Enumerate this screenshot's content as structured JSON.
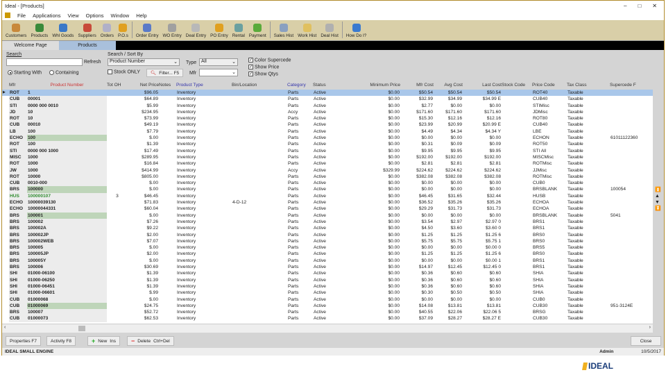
{
  "window": {
    "title": "Ideal - [Products]"
  },
  "menu": [
    "File",
    "Applications",
    "View",
    "Options",
    "Window",
    "Help"
  ],
  "toolbar": [
    {
      "label": "Customers",
      "color": "#c8883a"
    },
    {
      "label": "Products",
      "color": "#3a8a3a"
    },
    {
      "label": "Whl Goods",
      "color": "#3a78c8"
    },
    {
      "label": "Suppliers",
      "color": "#c84a3a"
    },
    {
      "label": "Orders",
      "color": "#b0b0c8"
    },
    {
      "label": "P.O.s",
      "color": "#e0a020"
    },
    {
      "label": "Order Entry",
      "color": "#5a7ac8"
    },
    {
      "label": "WO Entry",
      "color": "#a0a0a0"
    },
    {
      "label": "Deal Entry",
      "color": "#b8b8b8"
    },
    {
      "label": "PO Entry",
      "color": "#e0a020"
    },
    {
      "label": "Rental",
      "color": "#6aa0a0"
    },
    {
      "label": "Payment",
      "color": "#5aaa3a"
    },
    {
      "label": "Sales Hist",
      "color": "#8aa0c0"
    },
    {
      "label": "Work Hist",
      "color": "#e0c060"
    },
    {
      "label": "Deal Hist",
      "color": "#b0b0b0"
    },
    {
      "label": "How Do I?",
      "color": "#3a7ad0"
    }
  ],
  "tabs": [
    {
      "label": "Welcome Page"
    },
    {
      "label": "Products"
    }
  ],
  "search": {
    "label": "Search",
    "value": "",
    "refresh": "Refresh",
    "starting_with": "Starting With",
    "containing": "Containing",
    "sort_label": "Search / Sort By",
    "sort_value": "Product Number",
    "type_label": "Type",
    "type_value": "All",
    "mfr_label": "Mfr",
    "mfr_value": "",
    "stock_only": "Stock ONLY",
    "filter": "Filter... F5",
    "color_supercede": "Color Supercede",
    "show_price": "Show Price",
    "show_qtys": "Show Qtys"
  },
  "columns": [
    "Mfr",
    "Product Number",
    "Tot OH",
    "Net Price",
    "Notes",
    "Product Type",
    "Bin/Location",
    "Category",
    "Status",
    "Minimum Price",
    "Mfr Cost",
    "Avg Cost",
    "Last Cost",
    "Stock Code",
    "Price Code",
    "Tax Class",
    "Supercede F"
  ],
  "rows": [
    [
      "ROT",
      "1",
      "",
      "$96.05",
      "",
      "Inventory",
      "",
      "Parts",
      "Active",
      "$0.00",
      "$50.54",
      "$50.54",
      "$50.54",
      "",
      "ROT40",
      "Taxable",
      "",
      "sel"
    ],
    [
      "CUB",
      "00001",
      "",
      "$64.89",
      "",
      "Inventory",
      "",
      "Parts",
      "Active",
      "$0.00",
      "$32.99",
      "$34.99",
      "$34.99 E",
      "",
      "CUB40",
      "Taxable",
      "",
      ""
    ],
    [
      "STI",
      "0000 000 0010",
      "",
      "$5.99",
      "",
      "Inventory",
      "",
      "Parts",
      "Active",
      "$0.00",
      "$2.77",
      "$0.00",
      "$0.00",
      "",
      "STIMisc",
      "Taxable",
      "",
      ""
    ],
    [
      "JD",
      "10",
      "",
      "$234.95",
      "",
      "Inventory",
      "",
      "Accy",
      "Active",
      "$0.00",
      "$171.60",
      "$171.60",
      "$171.60",
      "",
      "JDMisc",
      "Taxable",
      "",
      ""
    ],
    [
      "ROT",
      "10",
      "",
      "$73.99",
      "",
      "Inventory",
      "",
      "Parts",
      "Active",
      "$0.00",
      "$15.30",
      "$12.16",
      "$12.16",
      "",
      "ROT80",
      "Taxable",
      "",
      ""
    ],
    [
      "CUB",
      "00010",
      "",
      "$49.19",
      "",
      "Inventory",
      "",
      "Parts",
      "Active",
      "$0.00",
      "$23.99",
      "$20.99",
      "$20.99 E",
      "",
      "CUB40",
      "Taxable",
      "",
      ""
    ],
    [
      "LB",
      "100",
      "",
      "$7.79",
      "",
      "Inventory",
      "",
      "Parts",
      "Active",
      "$0.00",
      "$4.49",
      "$4.34",
      "$4.34 Y",
      "",
      "LBE",
      "Taxable",
      "",
      ""
    ],
    [
      "ECHO",
      "100",
      "",
      "$.00",
      "",
      "Inventory",
      "",
      "Parts",
      "Active",
      "$0.00",
      "$0.00",
      "$0.00",
      "$0.00",
      "",
      "ECHON",
      "Taxable",
      "61011122360",
      "hl"
    ],
    [
      "ROT",
      "100",
      "",
      "$1.39",
      "",
      "Inventory",
      "",
      "Parts",
      "Active",
      "$0.00",
      "$0.31",
      "$0.09",
      "$0.09",
      "",
      "ROT50",
      "Taxable",
      "",
      ""
    ],
    [
      "STI",
      "0000 000 1000",
      "",
      "$17.49",
      "",
      "Inventory",
      "",
      "Parts",
      "Active",
      "$0.00",
      "$9.95",
      "$9.95",
      "$9.95",
      "",
      "STI All",
      "Taxable",
      "",
      ""
    ],
    [
      "MISC",
      "1000",
      "",
      "$289.95",
      "",
      "Inventory",
      "",
      "Parts",
      "Active",
      "$0.00",
      "$192.00",
      "$192.00",
      "$192.00",
      "",
      "MISCMisc",
      "Taxable",
      "",
      ""
    ],
    [
      "ROT",
      "1000",
      "",
      "$16.84",
      "",
      "Inventory",
      "",
      "Parts",
      "Active",
      "$0.00",
      "$2.81",
      "$2.81",
      "$2.81",
      "",
      "ROTMisc",
      "Taxable",
      "",
      ""
    ],
    [
      "JW",
      "1000",
      "",
      "$414.99",
      "",
      "Inventory",
      "",
      "Accy",
      "Active",
      "$329.99",
      "$224.62",
      "$224.62",
      "$224.62",
      "",
      "JJMisc",
      "Taxable",
      "",
      ""
    ],
    [
      "ROT",
      "10000",
      "",
      "$805.00",
      "",
      "Inventory",
      "",
      "Parts",
      "Active",
      "$0.00",
      "$382.08",
      "$382.08",
      "$382.08",
      "",
      "ROTMisc",
      "Taxable",
      "",
      ""
    ],
    [
      "CUB",
      "0010-000",
      "",
      "$.00",
      "",
      "Inventory",
      "",
      "Parts",
      "Active",
      "$0.00",
      "$0.00",
      "$0.00",
      "$0.00",
      "",
      "CUB0",
      "Taxable",
      "",
      ""
    ],
    [
      "BRS",
      "100000",
      "",
      "$.00",
      "",
      "Inventory",
      "",
      "Parts",
      "Active",
      "$0.00",
      "$0.00",
      "$0.00",
      "$0.00",
      "",
      "BRSBLANK",
      "Taxable",
      "100054",
      "hl"
    ],
    [
      "HUS",
      "100000107",
      "3",
      "$46.45",
      "",
      "Inventory",
      "",
      "Parts",
      "Active",
      "$0.00",
      "$46.45",
      "$31.65",
      "$32.44",
      "",
      "HUSB",
      "Taxable",
      "",
      "green"
    ],
    [
      "ECHO",
      "10000039130",
      "",
      "$71.83",
      "",
      "Inventory",
      "4-D-12",
      "Parts",
      "Active",
      "$0.00",
      "$36.52",
      "$35.26",
      "$35.26",
      "",
      "ECHOA",
      "Taxable",
      "",
      ""
    ],
    [
      "ECHO",
      "10000044331",
      "",
      "$60.04",
      "",
      "Inventory",
      "",
      "Parts",
      "Active",
      "$0.00",
      "$29.29",
      "$31.73",
      "$31.73",
      "",
      "ECHOA",
      "Taxable",
      "",
      ""
    ],
    [
      "BRS",
      "100001",
      "",
      "$.00",
      "",
      "Inventory",
      "",
      "Parts",
      "Active",
      "$0.00",
      "$0.00",
      "$0.00",
      "$0.00",
      "",
      "BRSBLANK",
      "Taxable",
      "5041",
      "hl"
    ],
    [
      "BRS",
      "100002",
      "",
      "$7.26",
      "",
      "Inventory",
      "",
      "Parts",
      "Active",
      "$0.00",
      "$3.54",
      "$2.97",
      "$2.97 0",
      "",
      "BRS1",
      "Taxable",
      "",
      ""
    ],
    [
      "BRS",
      "100002A",
      "",
      "$9.22",
      "",
      "Inventory",
      "",
      "Parts",
      "Active",
      "$0.00",
      "$4.50",
      "$3.60",
      "$3.60 0",
      "",
      "BRS1",
      "Taxable",
      "",
      ""
    ],
    [
      "BRS",
      "100002JP",
      "",
      "$2.00",
      "",
      "Inventory",
      "",
      "Parts",
      "Active",
      "$0.00",
      "$1.25",
      "$1.25",
      "$1.25 6",
      "",
      "BRS0",
      "Taxable",
      "",
      ""
    ],
    [
      "BRS",
      "100002WEB",
      "",
      "$7.07",
      "",
      "Inventory",
      "",
      "Parts",
      "Active",
      "$0.00",
      "$5.75",
      "$5.75",
      "$5.75 1",
      "",
      "BRS0",
      "Taxable",
      "",
      ""
    ],
    [
      "BRS",
      "100005",
      "",
      "$.00",
      "",
      "Inventory",
      "",
      "Parts",
      "Active",
      "$0.00",
      "$0.00",
      "$0.00",
      "$0.00 0",
      "",
      "BRS5",
      "Taxable",
      "",
      ""
    ],
    [
      "BRS",
      "100005JP",
      "",
      "$2.00",
      "",
      "Inventory",
      "",
      "Parts",
      "Active",
      "$0.00",
      "$1.25",
      "$1.25",
      "$1.25 6",
      "",
      "BRS0",
      "Taxable",
      "",
      ""
    ],
    [
      "BRS",
      "100005Y",
      "",
      "$.00",
      "",
      "Inventory",
      "",
      "Parts",
      "Active",
      "$0.00",
      "$0.00",
      "$0.00",
      "$0.00 1",
      "",
      "BRS1",
      "Taxable",
      "",
      ""
    ],
    [
      "BRS",
      "100006",
      "",
      "$30.69",
      "",
      "Inventory",
      "",
      "Parts",
      "Active",
      "$0.00",
      "$14.97",
      "$12.45",
      "$12.45 0",
      "",
      "BRS1",
      "Taxable",
      "",
      ""
    ],
    [
      "SHI",
      "01000-06100",
      "",
      "$1.39",
      "",
      "Inventory",
      "",
      "Parts",
      "Active",
      "$0.00",
      "$0.36",
      "$0.60",
      "$0.60",
      "",
      "SHIA",
      "Taxable",
      "",
      ""
    ],
    [
      "SHI",
      "01000-06250",
      "",
      "$1.39",
      "",
      "Inventory",
      "",
      "Parts",
      "Active",
      "$0.00",
      "$0.36",
      "$0.60",
      "$0.60",
      "",
      "SHIA",
      "Taxable",
      "",
      ""
    ],
    [
      "SHI",
      "01000-06451",
      "",
      "$1.39",
      "",
      "Inventory",
      "",
      "Parts",
      "Active",
      "$0.00",
      "$0.36",
      "$0.60",
      "$0.60",
      "",
      "SHIA",
      "Taxable",
      "",
      ""
    ],
    [
      "SHI",
      "01000-06601",
      "",
      "$.99",
      "",
      "Inventory",
      "",
      "Parts",
      "Active",
      "$0.00",
      "$0.30",
      "$0.50",
      "$0.50",
      "",
      "SHIA",
      "Taxable",
      "",
      ""
    ],
    [
      "CUB",
      "01000068",
      "",
      "$.00",
      "",
      "Inventory",
      "",
      "Parts",
      "Active",
      "$0.00",
      "$0.00",
      "$0.00",
      "$0.00",
      "",
      "CUB0",
      "Taxable",
      "",
      ""
    ],
    [
      "CUB",
      "01000069",
      "",
      "$24.75",
      "",
      "Inventory",
      "",
      "Parts",
      "Active",
      "$0.00",
      "$14.08",
      "$13.81",
      "$13.81",
      "",
      "CUB30",
      "Taxable",
      "951-3124E",
      "hl"
    ],
    [
      "BRS",
      "100007",
      "",
      "$52.72",
      "",
      "Inventory",
      "",
      "Parts",
      "Active",
      "$0.00",
      "$40.55",
      "$22.06",
      "$22.06 5",
      "",
      "BRSG",
      "Taxable",
      "",
      ""
    ],
    [
      "CUB",
      "01000073",
      "",
      "$62.53",
      "",
      "Inventory",
      "",
      "Parts",
      "Active",
      "$0.00",
      "$37.09",
      "$28.27",
      "$28.27 E",
      "",
      "CUB30",
      "Taxable",
      "",
      ""
    ]
  ],
  "bottom": {
    "properties": "Properties  F7",
    "activity": "Activity   F8",
    "new": "New",
    "new_key": "Ins",
    "delete": "Delete",
    "delete_key": "Ctrl+Del",
    "close": "Close"
  },
  "status": {
    "company": "IDEAL SMALL ENGINE",
    "user": "Admin",
    "date": "10/5/2017"
  },
  "brand": {
    "logo": "IDEAL"
  }
}
